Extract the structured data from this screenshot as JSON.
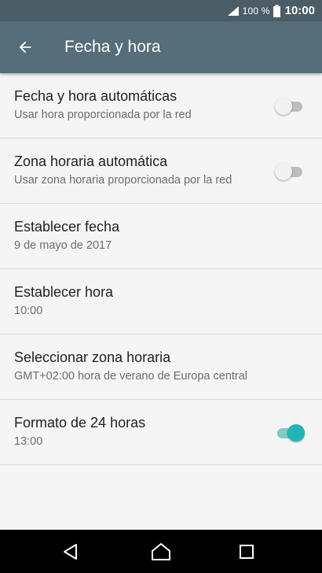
{
  "status_bar": {
    "battery_percent": "100 %",
    "time": "10:00",
    "signal_icon": "signal-icon",
    "battery_icon": "battery-icon"
  },
  "app_bar": {
    "title": "Fecha y hora",
    "back_icon": "arrow-back-icon"
  },
  "settings": [
    {
      "title": "Fecha y hora automáticas",
      "summary": "Usar hora proporcionada por la red",
      "switch_on": false
    },
    {
      "title": "Zona horaria automática",
      "summary": "Usar zona horaria proporcionada por la red",
      "switch_on": false
    },
    {
      "title": "Establecer fecha",
      "summary": "9 de mayo de 2017"
    },
    {
      "title": "Establecer hora",
      "summary": "10:00"
    },
    {
      "title": "Seleccionar zona horaria",
      "summary": "GMT+02:00 hora de verano de Europa central"
    },
    {
      "title": "Formato de 24 horas",
      "summary": "13:00",
      "switch_on": true
    }
  ],
  "nav_bar": {
    "icons": [
      "back-triangle-icon",
      "home-icon",
      "recents-icon"
    ]
  },
  "colors": {
    "status_bar": "#4b5d66",
    "app_bar": "#546e7a",
    "background": "#f5f5f5",
    "accent": "#1fb5b5"
  }
}
